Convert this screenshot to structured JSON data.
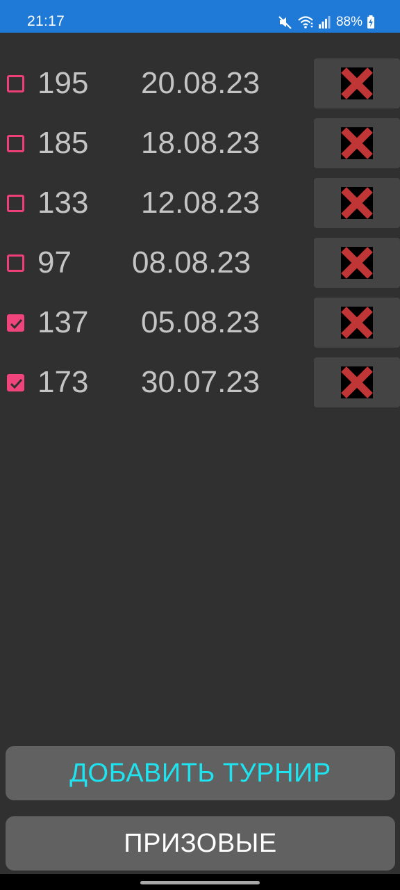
{
  "status_bar": {
    "time": "21:17",
    "battery": "88%",
    "icons": [
      "mute-icon",
      "wifi-icon",
      "signal-icon",
      "battery-charging-icon"
    ],
    "background": "#1e7ad6"
  },
  "tournaments": [
    {
      "number": "195",
      "date": "20.08.23",
      "checked": false
    },
    {
      "number": "185",
      "date": "18.08.23",
      "checked": false
    },
    {
      "number": "133",
      "date": "12.08.23",
      "checked": false
    },
    {
      "number": "97",
      "date": "08.08.23",
      "checked": false
    },
    {
      "number": "137",
      "date": "05.08.23",
      "checked": true
    },
    {
      "number": "173",
      "date": "30.07.23",
      "checked": true
    }
  ],
  "buttons": {
    "add_tournament": "ДОБАВИТЬ ТУРНИР",
    "prizes": "ПРИЗОВЫЕ"
  },
  "colors": {
    "accent_checkbox": "#f0447c",
    "add_button_text": "#1fe3ee",
    "delete_x": "#c03535",
    "background": "#303030"
  }
}
